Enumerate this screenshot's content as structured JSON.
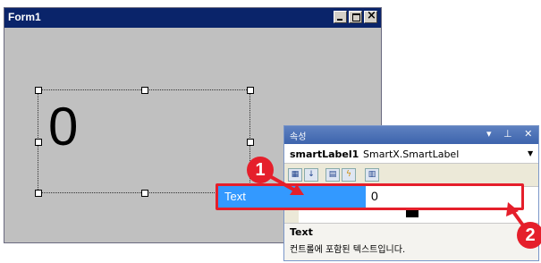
{
  "form": {
    "title": "Form1",
    "label_value": "0"
  },
  "properties": {
    "title": "속성",
    "pin_close": "▾ ⊥ ✕",
    "component_name": "smartLabel1",
    "component_type": "SmartX.SmartLabel",
    "selected_property": {
      "name": "Text",
      "value": "0"
    },
    "description": {
      "title": "Text",
      "text": "컨트롤에 포함된 텍스트입니다."
    }
  },
  "callouts": [
    "1",
    "2"
  ],
  "colors": {
    "highlight": "#3399ff",
    "callout": "#e51f2b",
    "title_bar": "#0a246a"
  }
}
